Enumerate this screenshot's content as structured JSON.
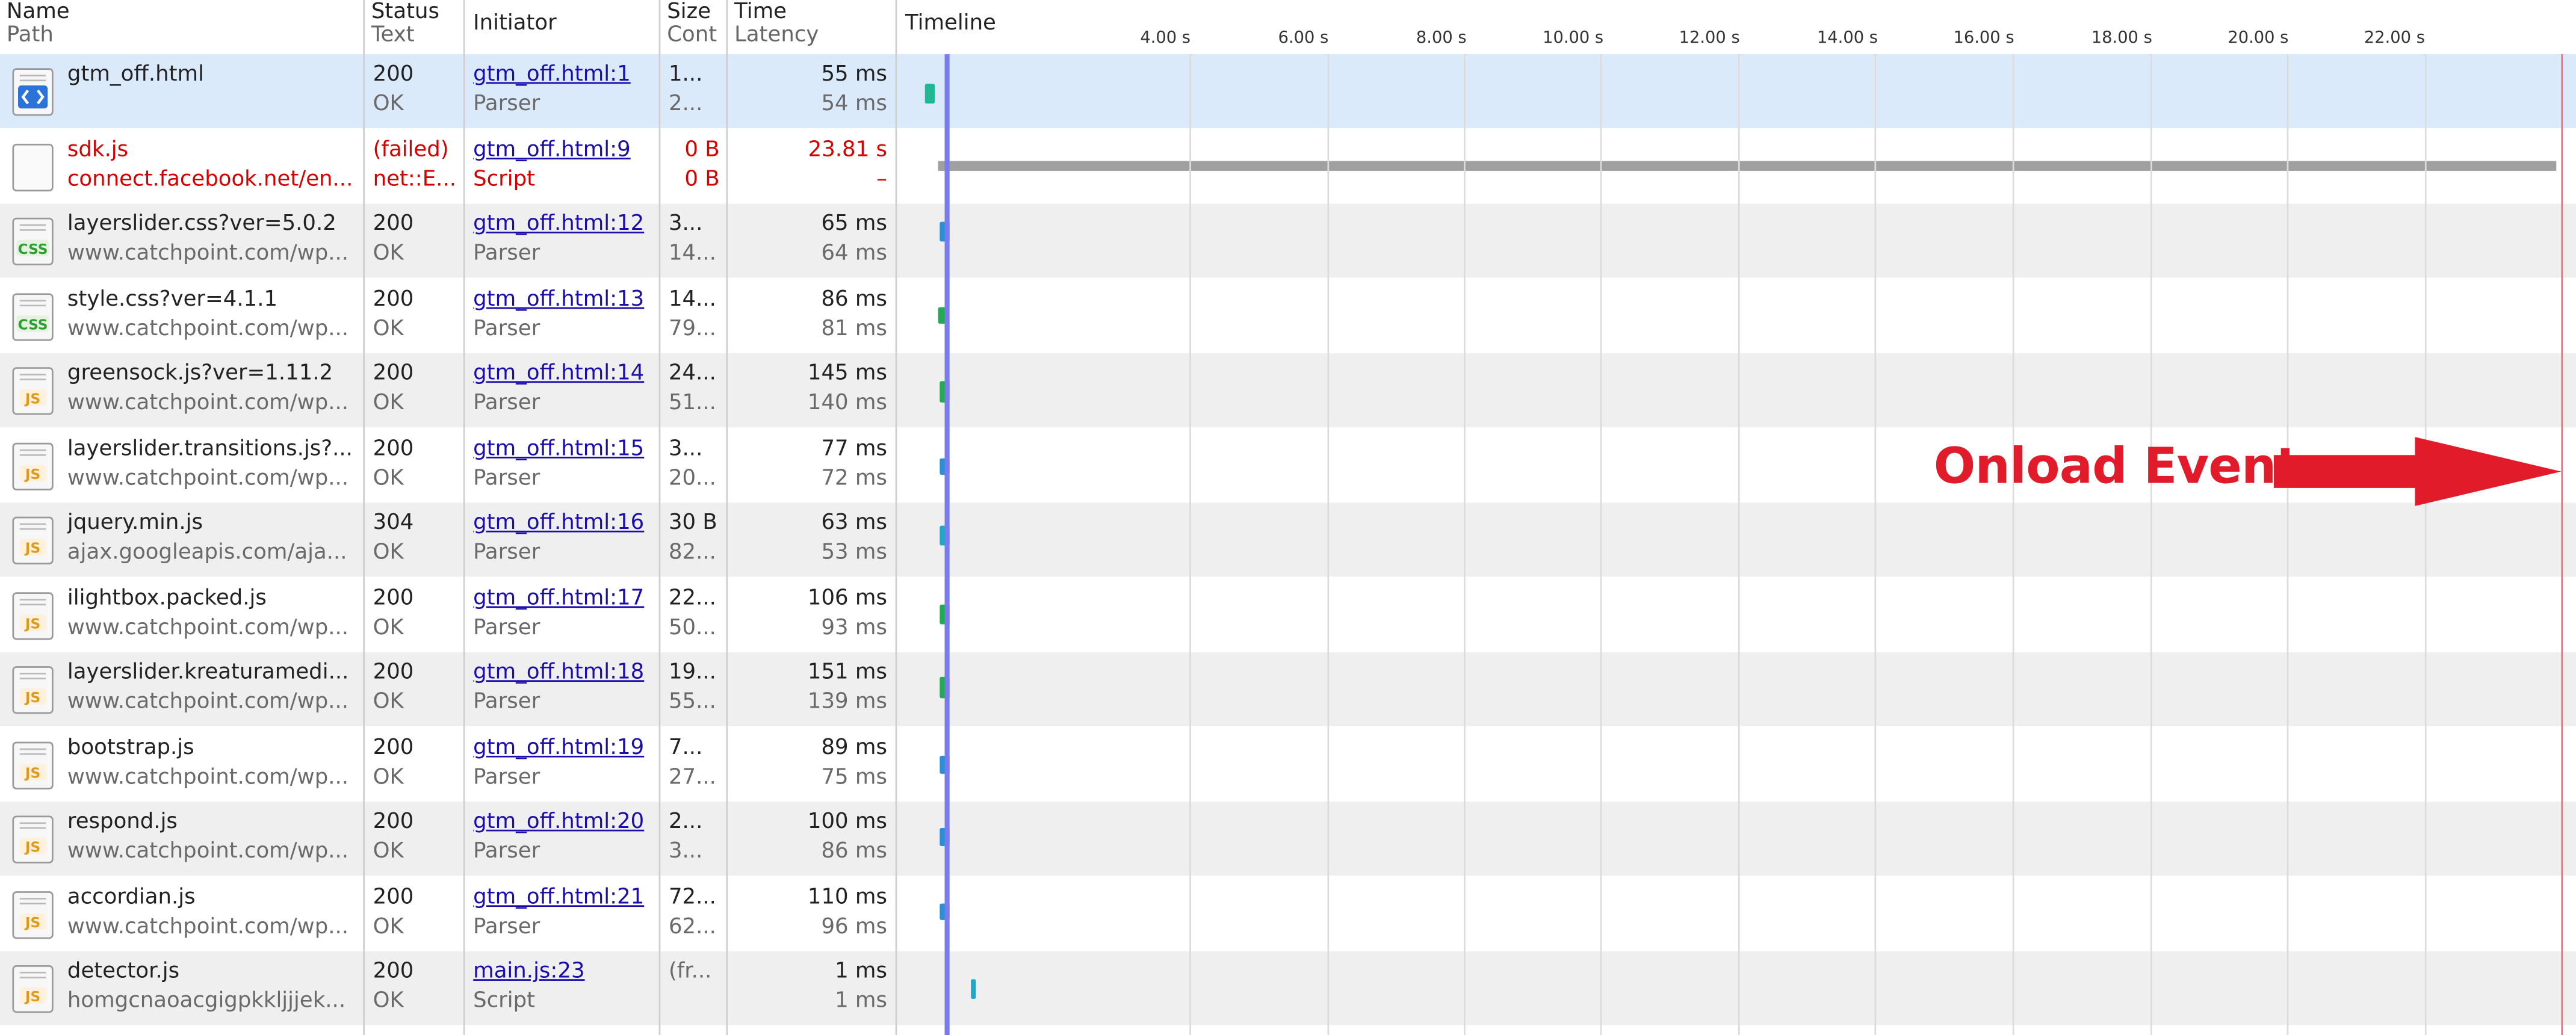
{
  "columns": {
    "name": "Name",
    "path": "Path",
    "status": "Status",
    "text": "Text",
    "initiator": "Initiator",
    "size": "Size",
    "content": "Cont",
    "time": "Time",
    "latency": "Latency",
    "timeline": "Timeline"
  },
  "timeline_ticks": [
    "4.00 s",
    "6.00 s",
    "8.00 s",
    "10.00 s",
    "12.00 s",
    "14.00 s",
    "16.00 s",
    "18.00 s",
    "20.00 s",
    "22.00 s"
  ],
  "annotation": {
    "label": "Onload Event",
    "color": "#e21b2b"
  },
  "colors": {
    "selected_row": "#dbeafb",
    "alt_row": "#efefef",
    "failed_text": "#d60000",
    "link": "#1a0dab",
    "dom_line": "#7b7bf0",
    "load_line": "#e8707a"
  },
  "requests": [
    {
      "icon": "html-file-icon",
      "name": "gtm_off.html",
      "path": "",
      "status": "200",
      "text": "OK",
      "initiator": "gtm_off.html:1",
      "initiator_type": "Parser",
      "size": "1...",
      "content": "2...",
      "time": "55 ms",
      "latency": "54 ms",
      "state": "selected",
      "bar_color": "#1fb893"
    },
    {
      "icon": "blank-file-icon",
      "name": "sdk.js",
      "path": "connect.facebook.net/en...",
      "status": "(failed)",
      "text": "net::E...",
      "initiator": "gtm_off.html:9",
      "initiator_type": "Script",
      "size": "0 B",
      "content": "0 B",
      "time": "23.81 s",
      "latency": "–",
      "state": "failed",
      "bar_color": "#a0a0a0"
    },
    {
      "icon": "css-file-icon",
      "name": "layerslider.css?ver=5.0.2",
      "path": "www.catchpoint.com/wp...",
      "status": "200",
      "text": "OK",
      "initiator": "gtm_off.html:12",
      "initiator_type": "Parser",
      "size": "3...",
      "content": "14...",
      "time": "65 ms",
      "latency": "64 ms",
      "state": "alt",
      "bar_color": "#2a8fd8"
    },
    {
      "icon": "css-file-icon",
      "name": "style.css?ver=4.1.1",
      "path": "www.catchpoint.com/wp...",
      "status": "200",
      "text": "OK",
      "initiator": "gtm_off.html:13",
      "initiator_type": "Parser",
      "size": "14...",
      "content": "79...",
      "time": "86 ms",
      "latency": "81 ms",
      "state": "normal",
      "bar_color": "#22aa55"
    },
    {
      "icon": "js-file-icon",
      "name": "greensock.js?ver=1.11.2",
      "path": "www.catchpoint.com/wp...",
      "status": "200",
      "text": "OK",
      "initiator": "gtm_off.html:14",
      "initiator_type": "Parser",
      "size": "24...",
      "content": "51...",
      "time": "145 ms",
      "latency": "140 ms",
      "state": "alt",
      "bar_color": "#22aa55"
    },
    {
      "icon": "js-file-icon",
      "name": "layerslider.transitions.js?...",
      "path": "www.catchpoint.com/wp...",
      "status": "200",
      "text": "OK",
      "initiator": "gtm_off.html:15",
      "initiator_type": "Parser",
      "size": "3...",
      "content": "20...",
      "time": "77 ms",
      "latency": "72 ms",
      "state": "normal",
      "bar_color": "#2a8fd8"
    },
    {
      "icon": "js-file-icon",
      "name": "jquery.min.js",
      "path": "ajax.googleapis.com/aja...",
      "status": "304",
      "text": "OK",
      "initiator": "gtm_off.html:16",
      "initiator_type": "Parser",
      "size": "30 B",
      "content": "82...",
      "time": "63 ms",
      "latency": "53 ms",
      "state": "alt",
      "bar_color": "#1fa7c9"
    },
    {
      "icon": "js-file-icon",
      "name": "ilightbox.packed.js",
      "path": "www.catchpoint.com/wp...",
      "status": "200",
      "text": "OK",
      "initiator": "gtm_off.html:17",
      "initiator_type": "Parser",
      "size": "22...",
      "content": "50...",
      "time": "106 ms",
      "latency": "93 ms",
      "state": "normal",
      "bar_color": "#22aa55"
    },
    {
      "icon": "js-file-icon",
      "name": "layerslider.kreaturamedi...",
      "path": "www.catchpoint.com/wp...",
      "status": "200",
      "text": "OK",
      "initiator": "gtm_off.html:18",
      "initiator_type": "Parser",
      "size": "19...",
      "content": "55...",
      "time": "151 ms",
      "latency": "139 ms",
      "state": "alt",
      "bar_color": "#22aa55"
    },
    {
      "icon": "js-file-icon",
      "name": "bootstrap.js",
      "path": "www.catchpoint.com/wp...",
      "status": "200",
      "text": "OK",
      "initiator": "gtm_off.html:19",
      "initiator_type": "Parser",
      "size": "7...",
      "content": "27...",
      "time": "89 ms",
      "latency": "75 ms",
      "state": "normal",
      "bar_color": "#2a8fd8"
    },
    {
      "icon": "js-file-icon",
      "name": "respond.js",
      "path": "www.catchpoint.com/wp...",
      "status": "200",
      "text": "OK",
      "initiator": "gtm_off.html:20",
      "initiator_type": "Parser",
      "size": "2...",
      "content": "3...",
      "time": "100 ms",
      "latency": "86 ms",
      "state": "alt",
      "bar_color": "#2a8fd8"
    },
    {
      "icon": "js-file-icon",
      "name": "accordian.js",
      "path": "www.catchpoint.com/wp...",
      "status": "200",
      "text": "OK",
      "initiator": "gtm_off.html:21",
      "initiator_type": "Parser",
      "size": "72...",
      "content": "62...",
      "time": "110 ms",
      "latency": "96 ms",
      "state": "normal",
      "bar_color": "#2a8fd8"
    },
    {
      "icon": "js-file-icon",
      "name": "detector.js",
      "path": "homgcnaoacgigpkkljjjek...",
      "status": "200",
      "text": "OK",
      "initiator": "main.js:23",
      "initiator_type": "Script",
      "size": "(fr...",
      "content": "",
      "time": "1 ms",
      "latency": "1 ms",
      "state": "alt",
      "bar_color": "#1fa7c9"
    }
  ]
}
